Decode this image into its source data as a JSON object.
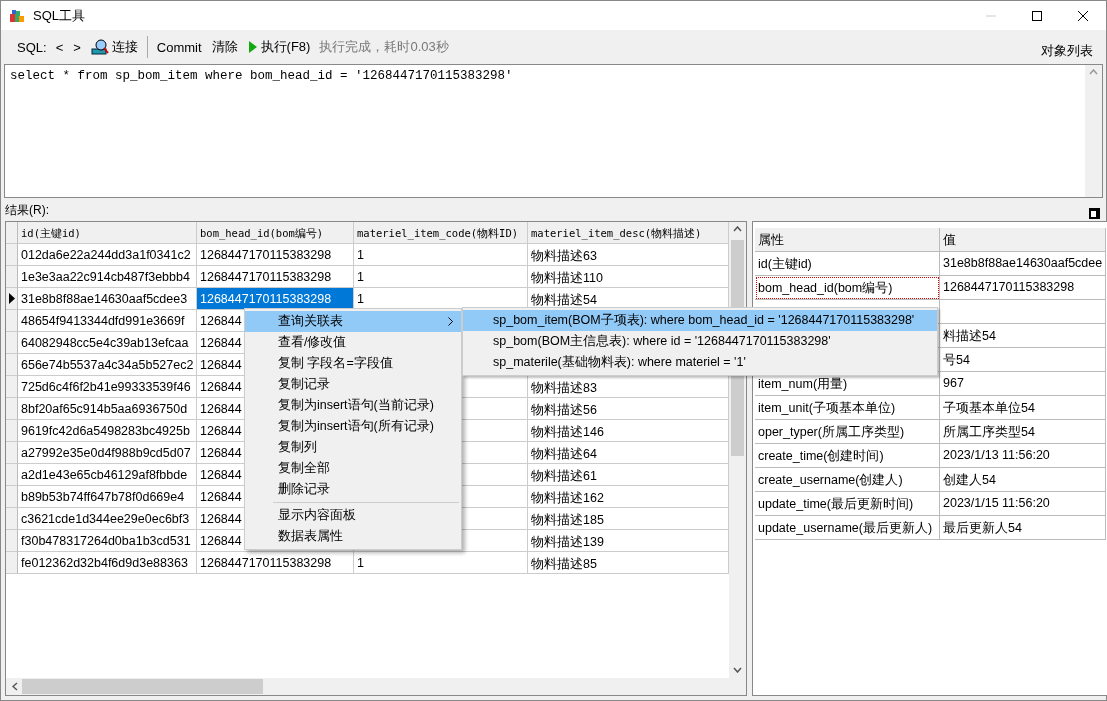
{
  "window": {
    "title": "SQL工具",
    "minimize_disabled": true
  },
  "toolbar": {
    "sql_label": "SQL:",
    "prev": "<",
    "next": ">",
    "connect": "连接",
    "commit": "Commit",
    "clear": "清除",
    "execute": "执行(F8)",
    "status": "执行完成，耗时0.03秒",
    "objects": "对象列表"
  },
  "editor": {
    "value": "select * from sp_bom_item where bom_head_id = '1268447170115383298'"
  },
  "results": {
    "label": "结果(R):",
    "columns": [
      {
        "label": "id(主键id)",
        "selected": false
      },
      {
        "label": "bom_head_id(bom编号)",
        "selected": true
      },
      {
        "label": "materiel_item_code(物料ID)",
        "selected": false
      },
      {
        "label": "materiel_item_desc(物料描述)",
        "selected": false
      }
    ],
    "rows": [
      {
        "selected": false,
        "id": "012da6e22a244dd3a1f0341c2",
        "bom_head_id": "1268447170115383298",
        "code": "1",
        "desc": "物料描述63"
      },
      {
        "selected": false,
        "id": "1e3e3aa22c914cb487f3ebbb4",
        "bom_head_id": "1268447170115383298",
        "code": "1",
        "desc": "物料描述110"
      },
      {
        "selected": true,
        "id": "31e8b8f88ae14630aaf5cdee3",
        "bom_head_id": "1268447170115383298",
        "code": "1",
        "desc": "物料描述54"
      },
      {
        "selected": false,
        "id": "48654f9413344dfd991e3669f",
        "bom_head_id": "126844"
      },
      {
        "selected": false,
        "id": "64082948cc5e4c39ab13efcaa",
        "bom_head_id": "126844"
      },
      {
        "selected": false,
        "id": "656e74b5537a4c34a5b527ec2",
        "bom_head_id": "126844"
      },
      {
        "selected": false,
        "id": "725d6c4f6f2b41e99333539f46",
        "bom_head_id": "126844",
        "desc": "物料描述83"
      },
      {
        "selected": false,
        "id": "8bf20af65c914b5aa6936750d",
        "bom_head_id": "126844",
        "desc": "物料描述56"
      },
      {
        "selected": false,
        "id": "9619fc42d6a5498283bc4925b",
        "bom_head_id": "126844",
        "desc": "物料描述146"
      },
      {
        "selected": false,
        "id": "a27992e35e0d4f988b9cd5d07",
        "bom_head_id": "126844",
        "desc": "物料描述64"
      },
      {
        "selected": false,
        "id": "a2d1e43e65cb46129af8fbbde",
        "bom_head_id": "126844",
        "desc": "物料描述61"
      },
      {
        "selected": false,
        "id": "b89b53b74ff647b78f0d669e4",
        "bom_head_id": "126844",
        "desc": "物料描述162"
      },
      {
        "selected": false,
        "id": "c3621cde1d344ee29e0ec6bf3",
        "bom_head_id": "126844",
        "desc": "物料描述185"
      },
      {
        "selected": false,
        "id": "f30b478317264d0ba1b3cd531",
        "bom_head_id": "126844",
        "desc": "物料描述139"
      },
      {
        "selected": false,
        "id": "fe012362d32b4f6d9d3e88363",
        "bom_head_id": "1268447170115383298",
        "code": "1",
        "desc": "物料描述85"
      }
    ]
  },
  "properties": {
    "columns": [
      "属性",
      "值"
    ],
    "rows": [
      {
        "focused": false,
        "name": "id(主键id)",
        "value": "31e8b8f88ae14630aaf5cdee"
      },
      {
        "focused": true,
        "name": "bom_head_id(bom编号)",
        "value": "1268447170115383298"
      },
      {
        "focused": false
      },
      {
        "value": "料描述54"
      },
      {
        "value": "号54"
      },
      {
        "focused": false,
        "name": "item_num(用量)",
        "value": "967"
      },
      {
        "focused": false,
        "name": "item_unit(子项基本单位)",
        "value": "子项基本单位54"
      },
      {
        "focused": false,
        "name": "oper_typer(所属工序类型)",
        "value": "所属工序类型54"
      },
      {
        "focused": false,
        "name": "create_time(创建时间)",
        "value": "2023/1/13 11:56:20"
      },
      {
        "focused": false,
        "name": "create_username(创建人)",
        "value": "创建人54"
      },
      {
        "focused": false,
        "name": "update_time(最后更新时间)",
        "value": "2023/1/15 11:56:20"
      },
      {
        "focused": false,
        "name": "update_username(最后更新人)",
        "value": "最后更新人54"
      }
    ]
  },
  "context_menu": {
    "items": [
      {
        "kind": "item",
        "label": "查询关联表",
        "highlighted": true,
        "has_submenu": true
      },
      {
        "kind": "item",
        "label": "查看/修改值",
        "highlighted": false,
        "has_submenu": false
      },
      {
        "kind": "item",
        "label": "复制 字段名=字段值",
        "highlighted": false,
        "has_submenu": false
      },
      {
        "kind": "item",
        "label": "复制记录",
        "highlighted": false,
        "has_submenu": false
      },
      {
        "kind": "item",
        "label": "复制为insert语句(当前记录)",
        "highlighted": false,
        "has_submenu": false
      },
      {
        "kind": "item",
        "label": "复制为insert语句(所有记录)",
        "highlighted": false,
        "has_submenu": false
      },
      {
        "kind": "item",
        "label": "复制列",
        "highlighted": false,
        "has_submenu": false
      },
      {
        "kind": "item",
        "label": "复制全部",
        "highlighted": false,
        "has_submenu": false
      },
      {
        "kind": "item",
        "label": "删除记录",
        "highlighted": false,
        "has_submenu": false
      },
      {
        "kind": "separator"
      },
      {
        "kind": "item",
        "label": "显示内容面板",
        "highlighted": false,
        "has_submenu": false
      },
      {
        "kind": "item",
        "label": "数据表属性",
        "highlighted": false,
        "has_submenu": false
      }
    ]
  },
  "submenu": {
    "items": [
      {
        "label": "sp_bom_item(BOM子项表): where bom_head_id = '1268447170115383298'",
        "highlighted": true
      },
      {
        "label": "sp_bom(BOM主信息表): where id = '1268447170115383298'",
        "highlighted": false
      },
      {
        "label": "sp_materile(基础物料表): where materiel = '1'",
        "highlighted": false
      }
    ]
  }
}
